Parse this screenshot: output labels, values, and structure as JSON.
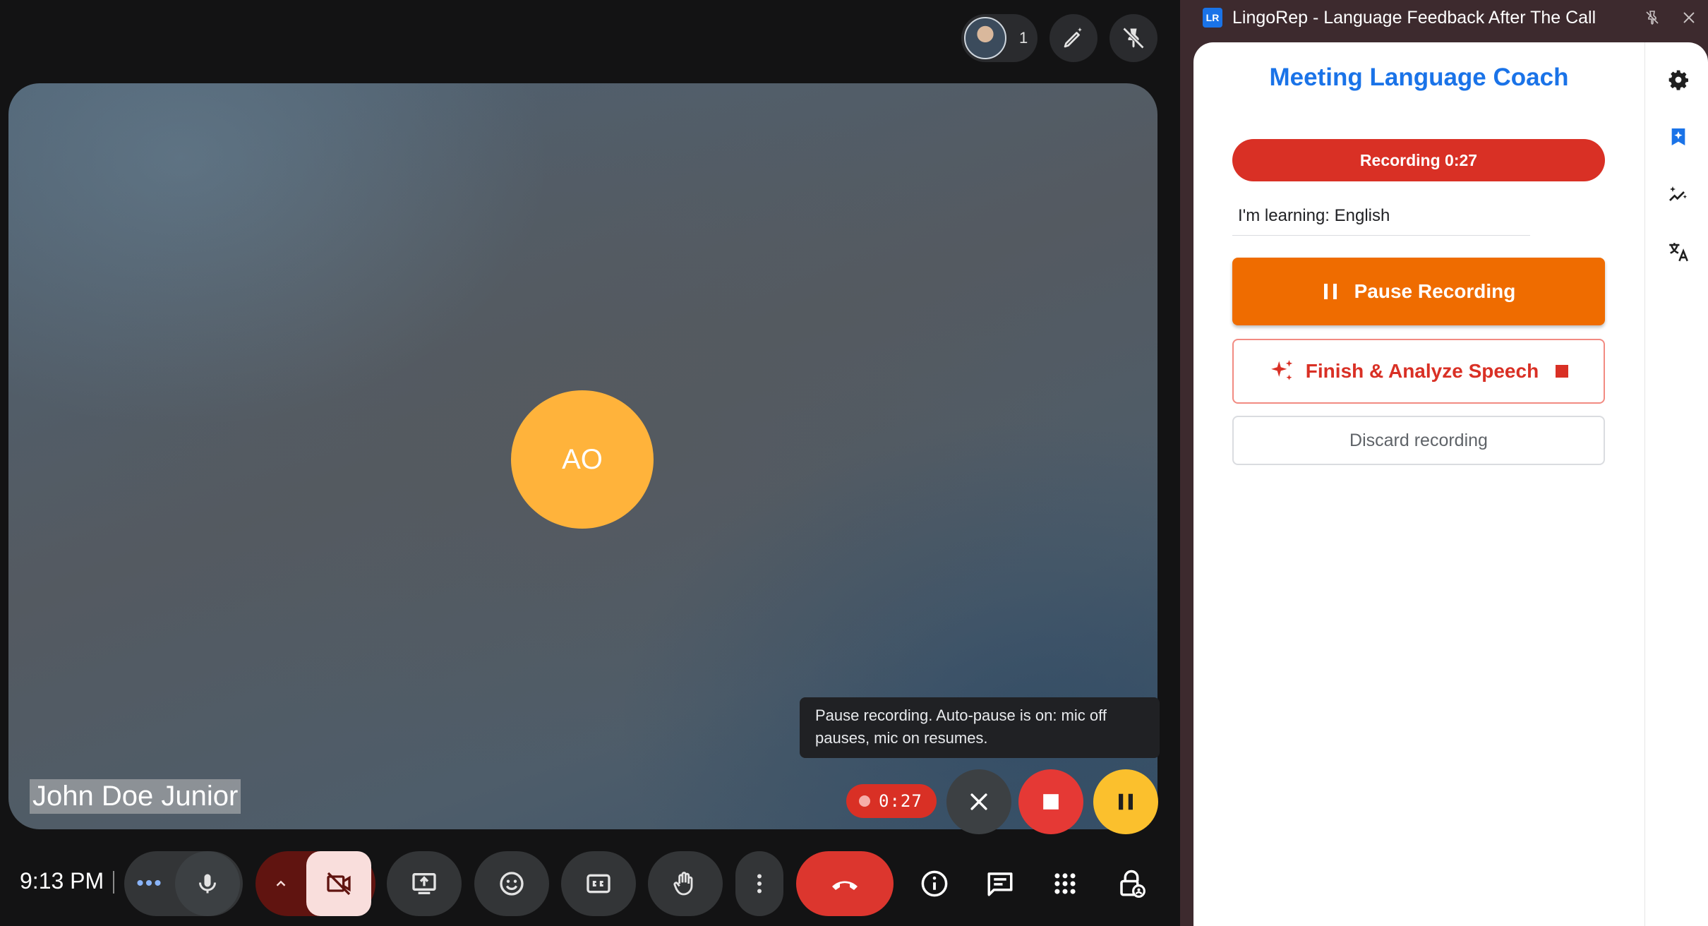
{
  "meet": {
    "participants_count": "1",
    "tile": {
      "avatar_initials": "AO",
      "participant_name": "John Doe Junior"
    },
    "tooltip": "Pause recording. Auto-pause is on: mic off pauses, mic on resumes.",
    "recording_chip_time": "0:27",
    "clock": "9:13 PM",
    "more_options_glyph": "•••",
    "icons": [
      "pencil-sparkle-icon",
      "pin-off-icon",
      "close-icon",
      "stop-icon",
      "pause-icon",
      "mic-icon",
      "chevron-up-icon",
      "camera-off-icon",
      "present-icon",
      "emoji-icon",
      "captions-icon",
      "raise-hand-icon",
      "more-vert-icon",
      "end-call-icon",
      "info-icon",
      "chat-icon",
      "apps-icon",
      "host-controls-icon"
    ]
  },
  "side_panel": {
    "logo_text": "LR",
    "window_title": "LingoRep - Language Feedback After The Call",
    "heading": "Meeting Language Coach",
    "recording_status": "Recording 0:27",
    "learning_label": "I'm learning: English",
    "pause_button": "Pause Recording",
    "finish_button": "Finish & Analyze Speech",
    "discard_button": "Discard recording",
    "rail_icons": [
      "gear-icon",
      "bookmark-sparkle-icon",
      "sparkle-chart-icon",
      "translate-icon"
    ]
  },
  "colors": {
    "accent_blue": "#1a73e8",
    "recording_red": "#d93025",
    "pause_orange": "#ef6c00",
    "avatar_yellow": "#ffb33b",
    "pause_ctrl_yellow": "#fbc02d"
  }
}
